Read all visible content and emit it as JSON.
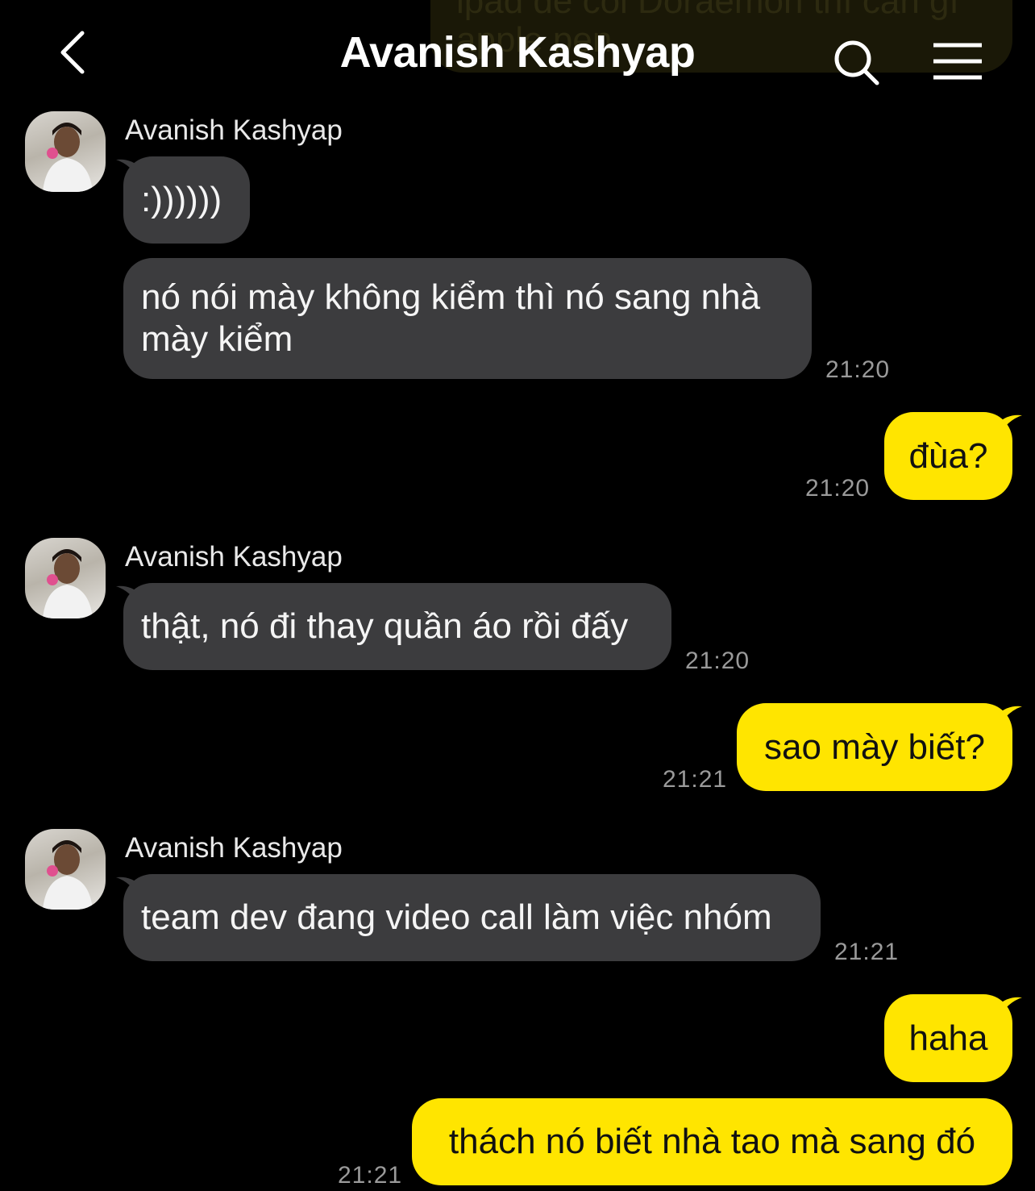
{
  "header": {
    "title": "Avanish Kashyap",
    "back_icon": "chevron-left-icon",
    "search_icon": "search-icon",
    "menu_icon": "hamburger-menu-icon"
  },
  "peek": {
    "text": "ipad để coi Doraemon thì cần gì\napple pen"
  },
  "colors": {
    "incoming": "#3c3c3e",
    "outgoing": "#ffe500",
    "background": "#000000"
  },
  "messages": {
    "g1": {
      "sender": "Avanish Kashyap",
      "m1": ":))))))",
      "m2_l1": "nó nói mày không kiểm thì nó sang nhà",
      "m2_l2": "mày kiểm",
      "time": "21:20"
    },
    "o1": {
      "text": "đùa?",
      "time": "21:20"
    },
    "g2": {
      "sender": "Avanish Kashyap",
      "m1": "thật, nó đi thay quần áo rồi đấy",
      "time": "21:20"
    },
    "o2": {
      "text": "sao mày biết?",
      "time": "21:21"
    },
    "g3": {
      "sender": "Avanish Kashyap",
      "m1": "team dev đang video call làm việc nhóm",
      "time": "21:21"
    },
    "o3": {
      "text": "haha"
    },
    "o4": {
      "text": "thách nó biết nhà tao mà sang đó",
      "time": "21:21"
    }
  }
}
